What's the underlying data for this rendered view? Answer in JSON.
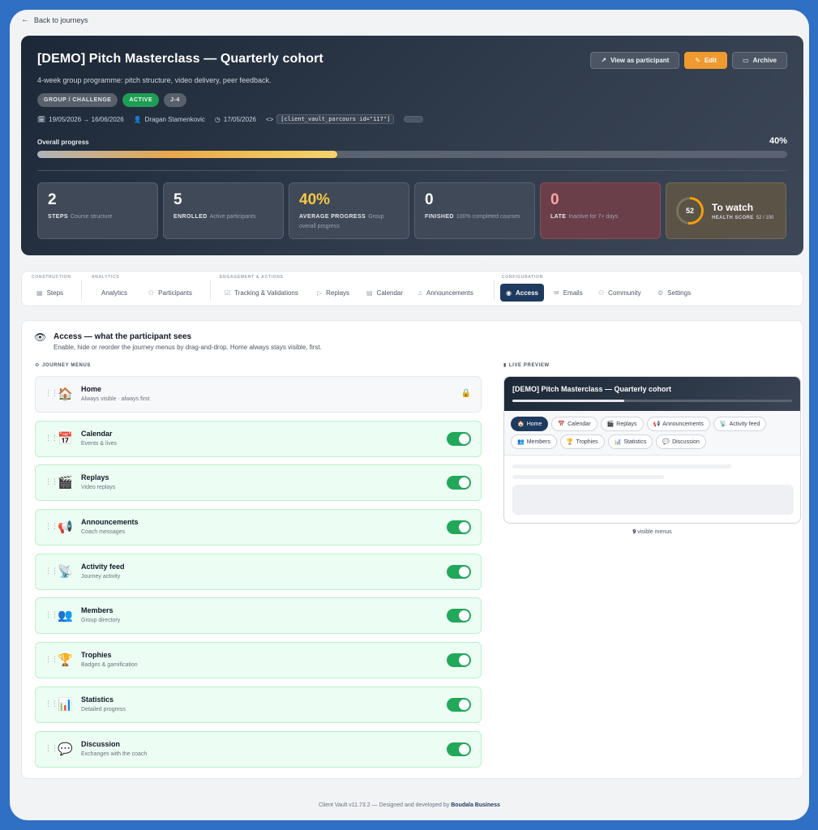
{
  "back_label": "Back to journeys",
  "hero": {
    "title": "[DEMO] Pitch Masterclass — Quarterly cohort",
    "subtitle": "4-week group programme: pitch structure, video delivery, peer feedback.",
    "tags": [
      "GROUP / CHALLENGE",
      "ACTIVE",
      "J-4"
    ],
    "dates": "19/05/2026 → 16/06/2026",
    "author": "Dragan Stamenkovic",
    "created": "17/05/2026",
    "shortcode": "[client_vault_parcours id=\"117\"]",
    "buttons": {
      "view": "View as participant",
      "edit": "Edit",
      "archive": "Archive"
    },
    "progress_label": "Overall progress",
    "progress_text": "40%",
    "progress_value": 40,
    "stats": [
      {
        "num": "2",
        "label": "STEPS",
        "desc": "Course structure"
      },
      {
        "num": "5",
        "label": "ENROLLED",
        "desc": "Active participants"
      },
      {
        "num": "40%",
        "label": "AVERAGE PROGRESS",
        "desc": "Group overall progress"
      },
      {
        "num": "0",
        "label": "FINISHED",
        "desc": "100% completed courses"
      },
      {
        "num": "0",
        "label": "LATE",
        "desc": "Inactive for 7+ days"
      }
    ],
    "watch": {
      "score": "52",
      "score_value": 52,
      "title": "To watch",
      "label": "HEALTH SCORE",
      "detail": "52 / 100"
    }
  },
  "nav": {
    "groups": [
      "CONSTRUCTION",
      "ANALYTICS",
      "ENGAGEMENT & ACTIONS",
      "CONFIGURATION"
    ],
    "items": [
      "Steps",
      "Analytics",
      "Participants",
      "Tracking & Validations",
      "Replays",
      "Calendar",
      "Announcements",
      "Access",
      "Emails",
      "Community",
      "Settings"
    ]
  },
  "access": {
    "title": "Access — what the participant sees",
    "subtitle": "Enable, hide or reorder the journey menus by drag-and-drop. Home always stays visible, first.",
    "menus_label": "JOURNEY MENUS",
    "preview_label": "LIVE PREVIEW",
    "menus": [
      {
        "name": "Home",
        "desc": "Always visible · always first",
        "emoji": "🏠"
      },
      {
        "name": "Calendar",
        "desc": "Events & lives",
        "emoji": "📅"
      },
      {
        "name": "Replays",
        "desc": "Video replays",
        "emoji": "🎬"
      },
      {
        "name": "Announcements",
        "desc": "Coach messages",
        "emoji": "📢"
      },
      {
        "name": "Activity feed",
        "desc": "Journey activity",
        "emoji": "📡"
      },
      {
        "name": "Members",
        "desc": "Group directory",
        "emoji": "👥"
      },
      {
        "name": "Trophies",
        "desc": "Badges & gamification",
        "emoji": "🏆"
      },
      {
        "name": "Statistics",
        "desc": "Detailed progress",
        "emoji": "📊"
      },
      {
        "name": "Discussion",
        "desc": "Exchanges with the coach",
        "emoji": "💬"
      }
    ],
    "preview": {
      "title": "[DEMO] Pitch Masterclass — Quarterly cohort",
      "progress_value": 40,
      "chips": [
        "Home",
        "Calendar",
        "Replays",
        "Announcements",
        "Activity feed",
        "Members",
        "Trophies",
        "Statistics",
        "Discussion"
      ]
    },
    "visible_count": "9",
    "visible_text": "visible menus"
  },
  "footer": {
    "text": "Client Vault v11.73.2 — Designed and developed by",
    "brand": "Boudala Business"
  },
  "colors": {
    "accent": "#1e3a5f",
    "edit": "#ee9a2e",
    "toggle_on": "#22a85a",
    "active_tag": "#1f9d55"
  }
}
